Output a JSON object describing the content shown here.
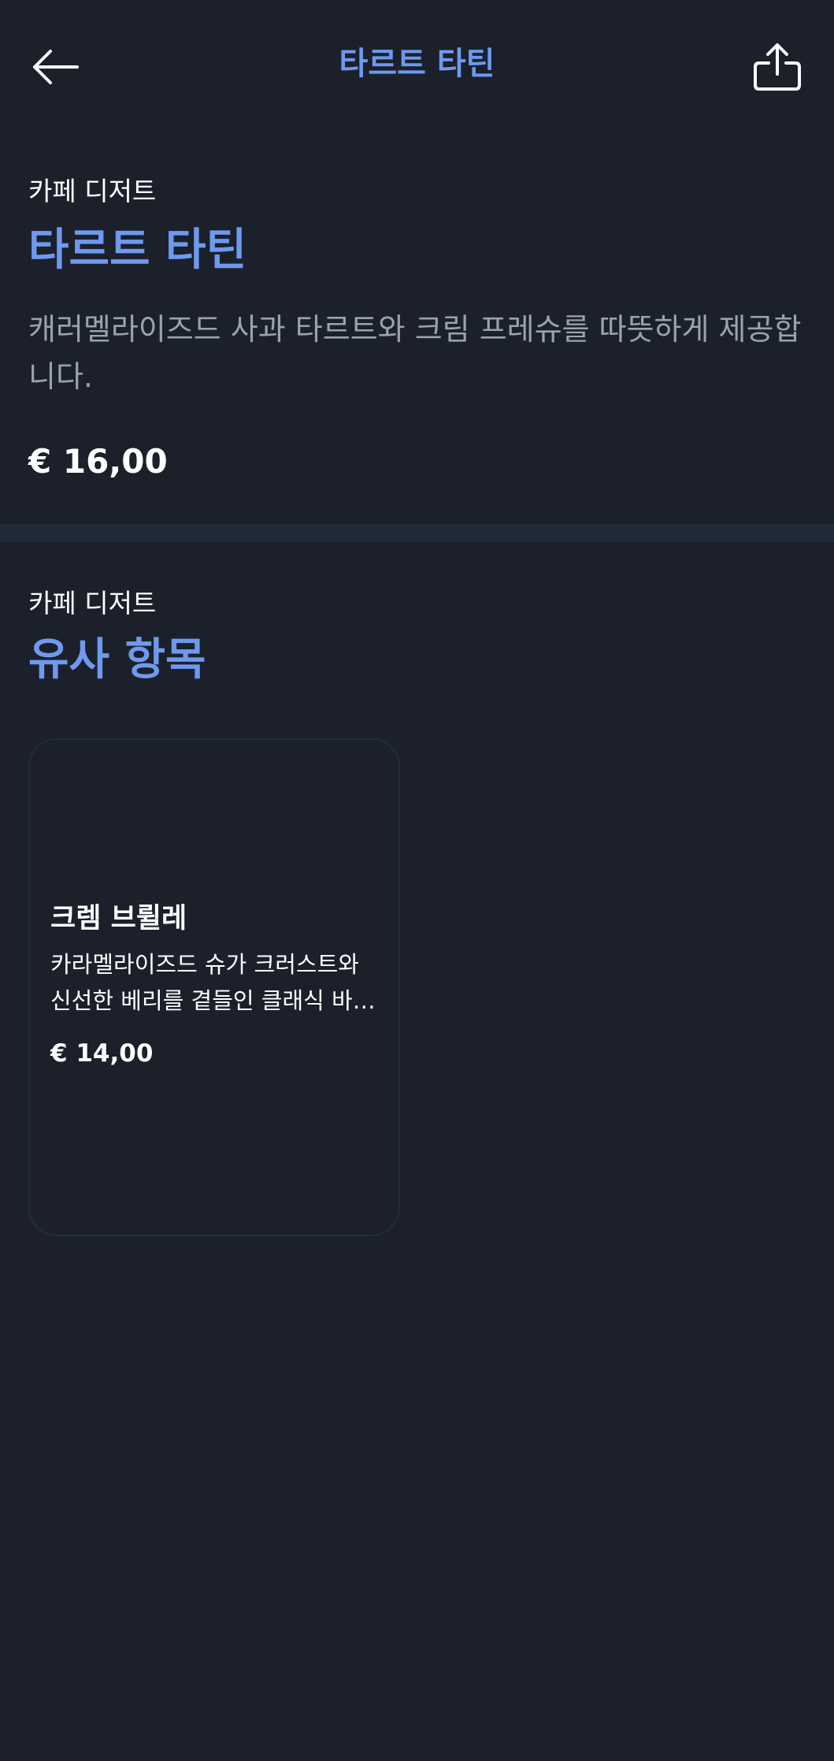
{
  "header": {
    "title": "타르트 타틴",
    "back_icon": "arrow-left-icon",
    "share_icon": "share-icon"
  },
  "product": {
    "category": "카페 디저트",
    "name": "타르트 타틴",
    "description": "캐러멜라이즈드 사과 타르트와 크림 프레슈를 따뜻하게 제공합니다.",
    "price": "€ 16,00"
  },
  "similar": {
    "category": "카페 디저트",
    "title": "유사 항목",
    "items": [
      {
        "name": "크렘 브륄레",
        "description": "카라멜라이즈드 슈가 크러스트와 신선한 베리를 곁들인 클래식 바닐라 커스터드",
        "price": "€ 14,00"
      }
    ]
  },
  "colors": {
    "background": "#1b202b",
    "accent": "#6f99ee",
    "divider": "#212a38",
    "card_border": "#232c3a",
    "muted_text": "#9aa2b1"
  }
}
